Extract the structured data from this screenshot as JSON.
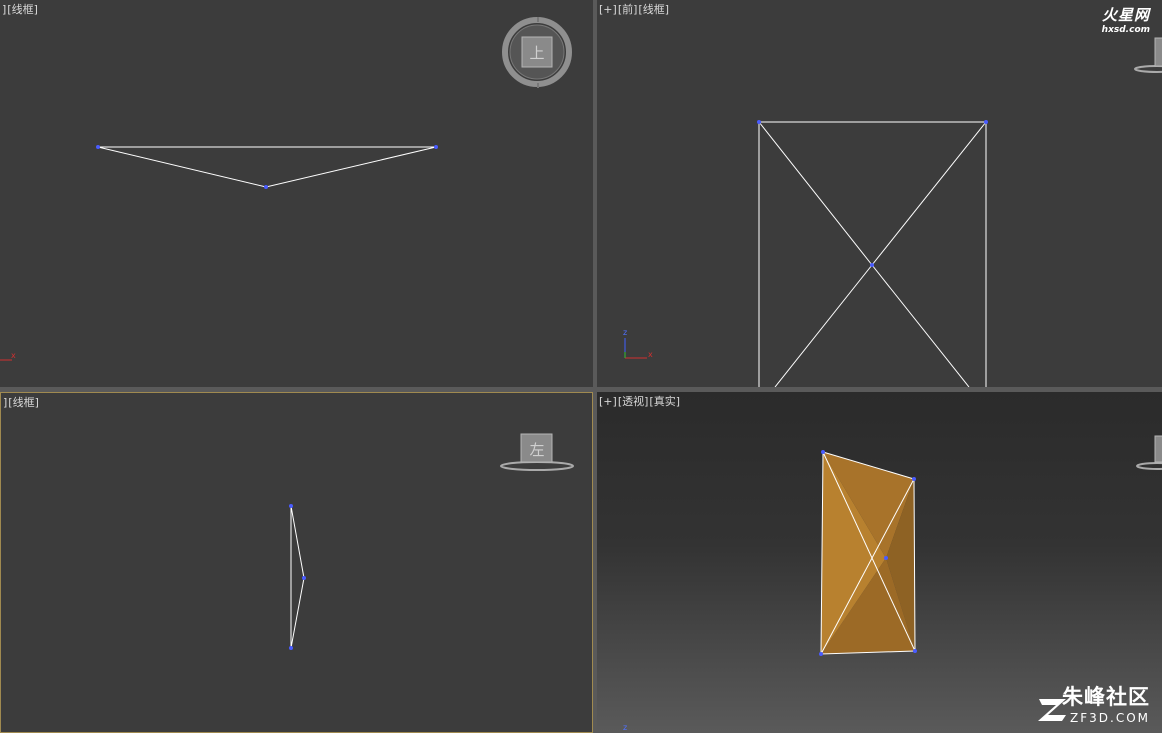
{
  "viewports": {
    "top": {
      "labels": [
        "]",
        "[线框]"
      ]
    },
    "front": {
      "labels": [
        "[+]",
        "[前]",
        "[线框]"
      ]
    },
    "left": {
      "labels": [
        "]",
        "[线框]"
      ]
    },
    "persp": {
      "labels": [
        "[+]",
        "[透视]",
        "[真实]"
      ]
    }
  },
  "viewcube": {
    "top_face": "上",
    "left_face": "左"
  },
  "axis": {
    "z": "z",
    "x": "x"
  },
  "watermarks": {
    "top_right_title": "火星网",
    "top_right_url": "hxsd.com",
    "bottom_right_title": "朱峰社区",
    "bottom_right_url": "ZF3D.COM"
  },
  "colors": {
    "viewport_bg": "#3c3c3c",
    "wire": "#ffffff",
    "vertex": "#4a5cff",
    "active_border": "#a08a50",
    "mesh_fill": "#b07a2c"
  }
}
